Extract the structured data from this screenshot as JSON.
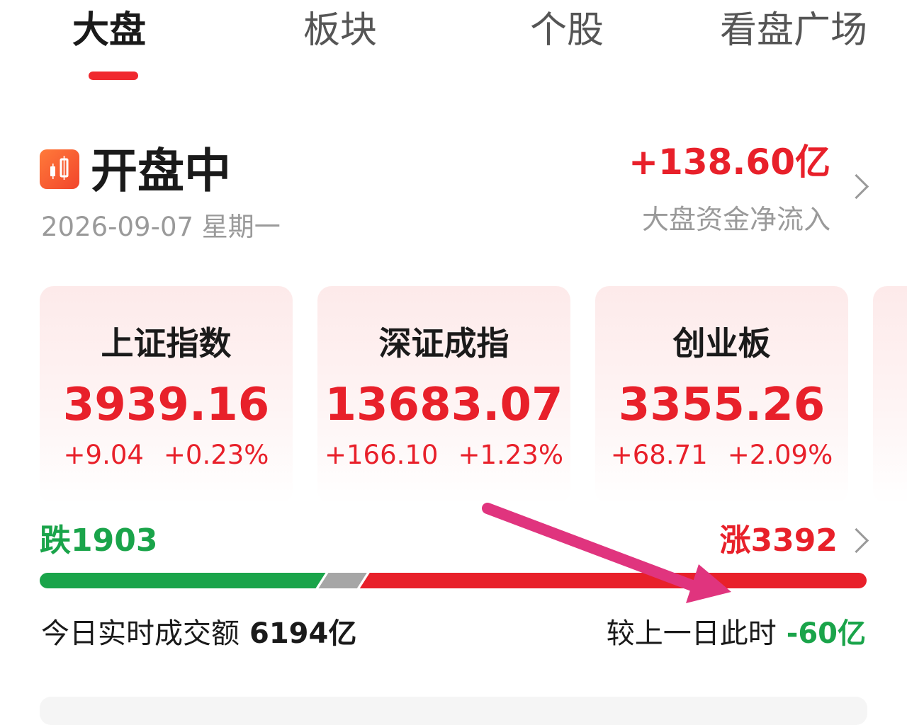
{
  "tabs": [
    {
      "label": "大盘",
      "active": true
    },
    {
      "label": "板块",
      "active": false
    },
    {
      "label": "个股",
      "active": false
    },
    {
      "label": "看盘广场",
      "active": false
    }
  ],
  "status": {
    "title": "开盘中",
    "date": "2026-09-07 星期一",
    "icon": "candlestick-icon"
  },
  "fund_flow": {
    "value": "+138.60亿",
    "label": "大盘资金净流入"
  },
  "indices": [
    {
      "name": "上证指数",
      "value": "3939.16",
      "change": "+9.04",
      "percent": "+0.23%"
    },
    {
      "name": "深证成指",
      "value": "13683.07",
      "change": "+166.10",
      "percent": "+1.23%"
    },
    {
      "name": "创业板",
      "value": "3355.26",
      "change": "+68.71",
      "percent": "+2.09%"
    }
  ],
  "breadth": {
    "fall_label": "跌1903",
    "rise_label": "涨3392",
    "fall_count": 1903,
    "rise_count": 3392,
    "flat_fraction": 0.05
  },
  "volume": {
    "label": "今日实时成交额",
    "value": "6194亿",
    "compare_label": "较上一日此时",
    "compare_value": "-60亿"
  },
  "colors": {
    "up": "#e8202a",
    "down": "#1aa44a",
    "flat": "#a6a6a6",
    "accent": "#f0282e",
    "annotation_arrow": "#e0347e"
  }
}
